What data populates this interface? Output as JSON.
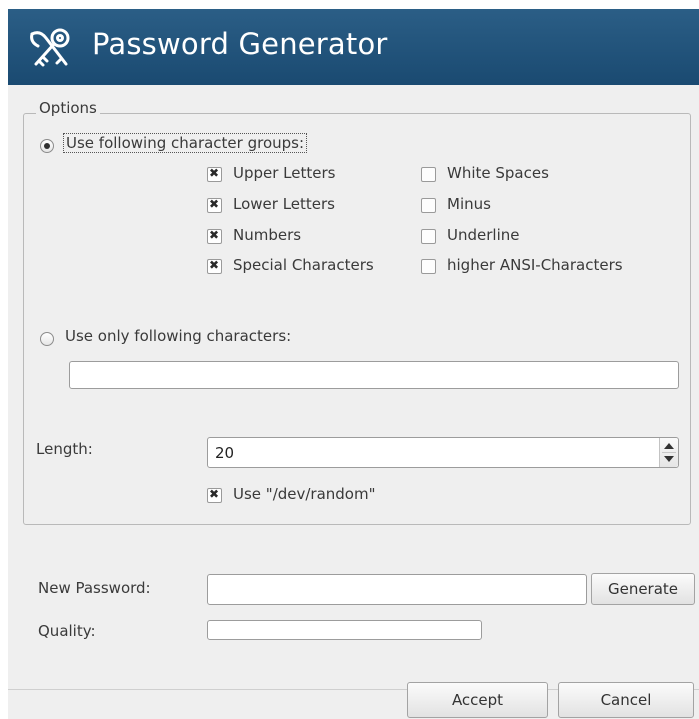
{
  "window": {
    "title": "Password Generator",
    "icon": "keys-icon"
  },
  "options": {
    "group_title": "Options",
    "use_groups_label": "Use following character groups:",
    "use_groups_selected": true,
    "groups_left": [
      {
        "label": "Upper Letters",
        "checked": true
      },
      {
        "label": "Lower Letters",
        "checked": true
      },
      {
        "label": "Numbers",
        "checked": true
      },
      {
        "label": "Special Characters",
        "checked": true
      }
    ],
    "groups_right": [
      {
        "label": "White Spaces",
        "checked": false
      },
      {
        "label": "Minus",
        "checked": false
      },
      {
        "label": "Underline",
        "checked": false
      },
      {
        "label": "higher ANSI-Characters",
        "checked": false
      }
    ],
    "use_only_label": "Use only following characters:",
    "use_only_selected": false,
    "only_chars_value": "",
    "length_label": "Length:",
    "length_value": "20",
    "dev_random_label": "Use \"/dev/random\"",
    "dev_random_checked": true
  },
  "result": {
    "new_password_label": "New Password:",
    "new_password_value": "",
    "generate_label": "Generate",
    "quality_label": "Quality:",
    "quality_fraction": 0
  },
  "footer": {
    "accept_label": "Accept",
    "cancel_label": "Cancel"
  }
}
